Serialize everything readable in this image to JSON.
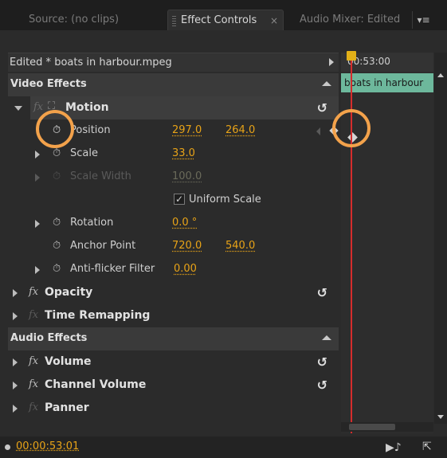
{
  "tabs": {
    "source": "Source: (no clips)",
    "effect_controls": "Effect Controls",
    "effect_controls_close": "×",
    "audio_mixer": "Audio Mixer: Edited",
    "menu": "▾≡"
  },
  "clip": {
    "title": "Edited * boats in harbour.mpeg"
  },
  "timeline": {
    "timecode": "00:53:00",
    "clip_name": "boats in harbour"
  },
  "video_effects": {
    "label": "Video Effects",
    "motion": {
      "name": "Motion",
      "position": {
        "label": "Position",
        "x": "297.0",
        "y": "264.0"
      },
      "scale": {
        "label": "Scale",
        "value": "33.0"
      },
      "scale_width": {
        "label": "Scale Width",
        "value": "100.0"
      },
      "uniform_scale": {
        "label": "Uniform Scale",
        "checked": true
      },
      "rotation": {
        "label": "Rotation",
        "value": "0.0 °"
      },
      "anchor_point": {
        "label": "Anchor Point",
        "x": "720.0",
        "y": "540.0"
      },
      "anti_flicker": {
        "label": "Anti-flicker Filter",
        "value": "0.00"
      }
    },
    "opacity": "Opacity",
    "time_remapping": "Time Remapping"
  },
  "audio_effects": {
    "label": "Audio Effects",
    "volume": "Volume",
    "channel_volume": "Channel Volume",
    "panner": "Panner"
  },
  "footer": {
    "timecode": "00:00:53:01"
  },
  "icons": {
    "reset": "↺",
    "fx": "fx",
    "stopwatch": "⏱",
    "check": "✓"
  },
  "colors": {
    "value": "#e8a317",
    "clip": "#6db89c",
    "playhead": "#d62c2c",
    "highlight": "#f3a24b"
  }
}
